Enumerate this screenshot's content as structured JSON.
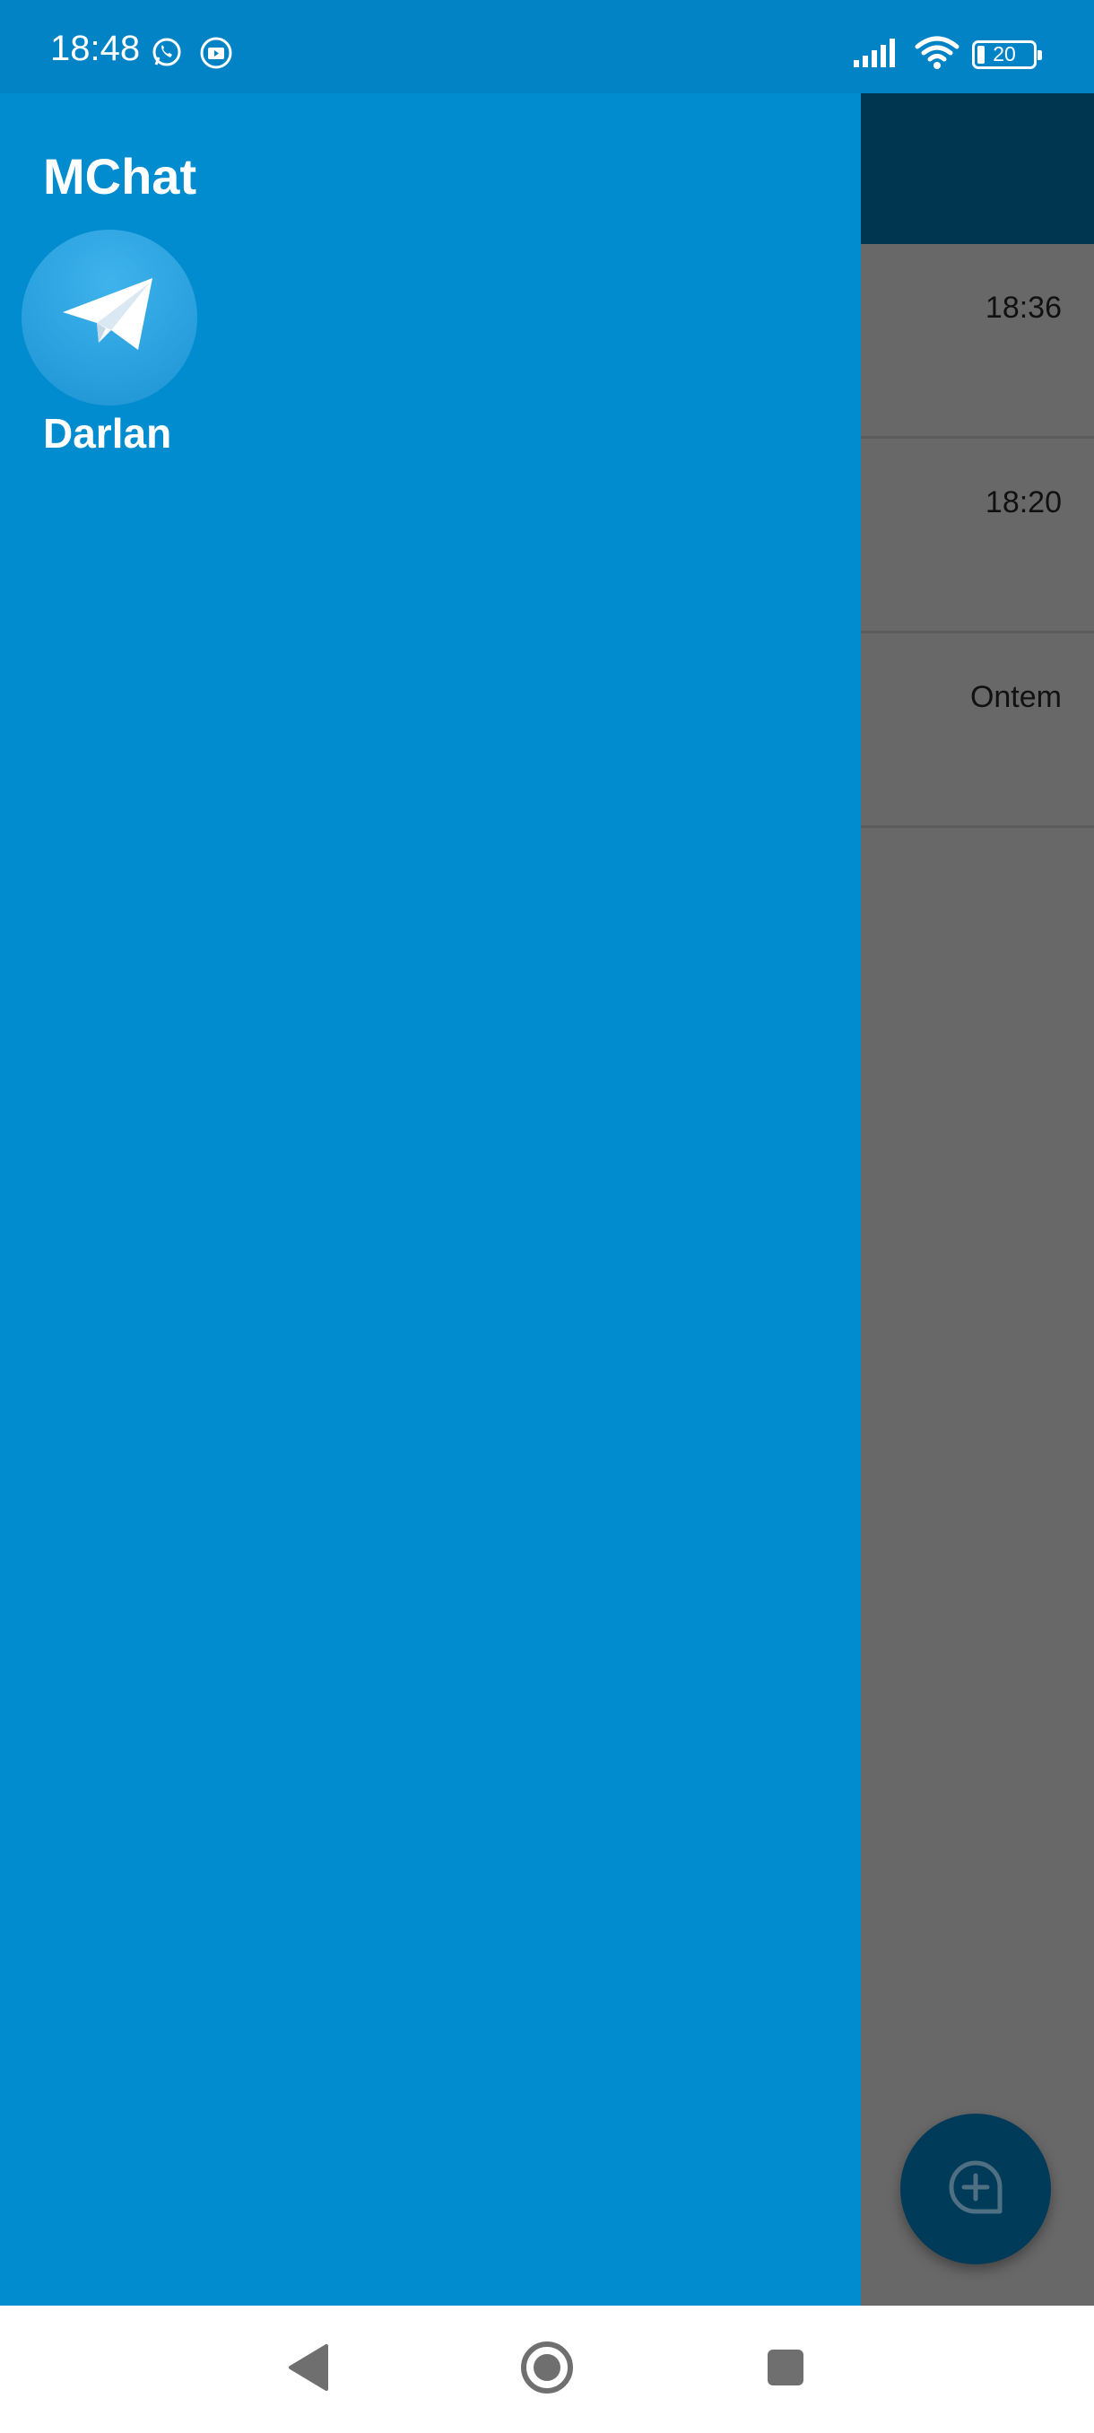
{
  "status_bar": {
    "time": "18:48",
    "battery_level": "20",
    "icons": [
      "whatsapp-icon",
      "media-notification-icon",
      "signal-icon",
      "wifi-icon",
      "battery-icon"
    ]
  },
  "drawer": {
    "app_title": "MChat",
    "user_name": "Darlan",
    "avatar_icon": "telegram-plane-icon",
    "background_color": "#008ccf"
  },
  "background_chats": {
    "items": [
      {
        "time": "18:36"
      },
      {
        "time": "18:20"
      },
      {
        "time": "Ontem"
      }
    ],
    "fab_icon": "new-chat-icon"
  },
  "nav_bar": {
    "buttons": [
      "back-icon",
      "home-icon",
      "recents-icon"
    ]
  }
}
